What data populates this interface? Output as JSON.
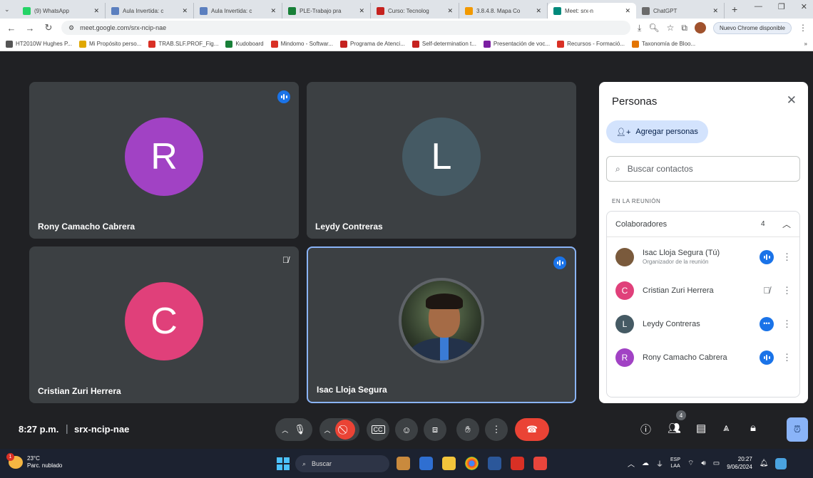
{
  "browser": {
    "tabs": [
      {
        "label": "(9) WhatsApp",
        "color": "#25d366",
        "active": false
      },
      {
        "label": "Aula Invertida: c",
        "color": "#5b7fbf",
        "active": false
      },
      {
        "label": "Aula Invertida: c",
        "color": "#5b7fbf",
        "active": false
      },
      {
        "label": "PLE-Trabajo pra",
        "color": "#188038",
        "active": false
      },
      {
        "label": "Curso: Tecnolog",
        "color": "#c5221f",
        "active": false
      },
      {
        "label": "3.8.4.8. Mapa Co",
        "color": "#f29900",
        "active": false
      },
      {
        "label": "Meet: srx-n",
        "color": "#00897b",
        "active": true
      },
      {
        "label": "ChatGPT",
        "color": "#6b6b6b",
        "active": false
      }
    ],
    "url": "meet.google.com/srx-ncip-nae",
    "update_label": "Nuevo Chrome disponible",
    "bookmarks": [
      {
        "label": "HT2010W Hughes P...",
        "color": "#555555"
      },
      {
        "label": "Mi Propósito perso...",
        "color": "#e0a800"
      },
      {
        "label": "TRAB.SLF.PROF_Fig...",
        "color": "#d93025"
      },
      {
        "label": "Kudoboard",
        "color": "#188038"
      },
      {
        "label": "Mindomo - Softwar...",
        "color": "#d93025"
      },
      {
        "label": "Programa de Atenci...",
        "color": "#c5221f"
      },
      {
        "label": "Self-determination t...",
        "color": "#c5221f"
      },
      {
        "label": "Presentación de voc...",
        "color": "#7b1fa2"
      },
      {
        "label": "Recursos - Formació...",
        "color": "#d93025"
      },
      {
        "label": "Taxonomía de Bloo...",
        "color": "#e37400"
      }
    ],
    "bookmarks_more": "»"
  },
  "tiles": [
    {
      "name": "Rony Camacho Cabrera",
      "initial": "R",
      "avatar_color": "#a142c4",
      "status": "speaking",
      "highlight": false
    },
    {
      "name": "Leydy Contreras",
      "initial": "L",
      "avatar_color": "#455a64",
      "status": "none",
      "highlight": false
    },
    {
      "name": "Cristian Zuri Herrera",
      "initial": "C",
      "avatar_color": "#e0407a",
      "status": "muted",
      "highlight": false
    },
    {
      "name": "Isac Lloja Segura",
      "initial": "",
      "avatar_color": "#5f6368",
      "status": "speaking",
      "highlight": true
    }
  ],
  "panel": {
    "title": "Personas",
    "add_label": "Agregar personas",
    "search_placeholder": "Buscar contactos",
    "section_label": "EN LA REUNIÓN",
    "group_name": "Colaboradores",
    "group_count": "4",
    "participants": [
      {
        "name": "Isac Lloja Segura (Tú)",
        "sub": "Organizador de la reunión",
        "initial": "",
        "color": "#7a5a3c",
        "status": "speaking"
      },
      {
        "name": "Cristian Zuri Herrera",
        "sub": "",
        "initial": "C",
        "color": "#e0407a",
        "status": "muted"
      },
      {
        "name": "Leydy Contreras",
        "sub": "",
        "initial": "L",
        "color": "#455a64",
        "status": "dots"
      },
      {
        "name": "Rony Camacho Cabrera",
        "sub": "",
        "initial": "R",
        "color": "#a142c4",
        "status": "speaking"
      }
    ]
  },
  "meeting": {
    "time": "8:27 p.m.",
    "code": "srx-ncip-nae",
    "people_count": "4"
  },
  "taskbar": {
    "temp": "23°C",
    "weather": "Parc. nublado",
    "weather_badge": "1",
    "search_label": "Buscar",
    "lang_top": "ESP",
    "lang_bottom": "LAA",
    "clock_time": "20:27",
    "clock_date": "9/06/2024"
  }
}
